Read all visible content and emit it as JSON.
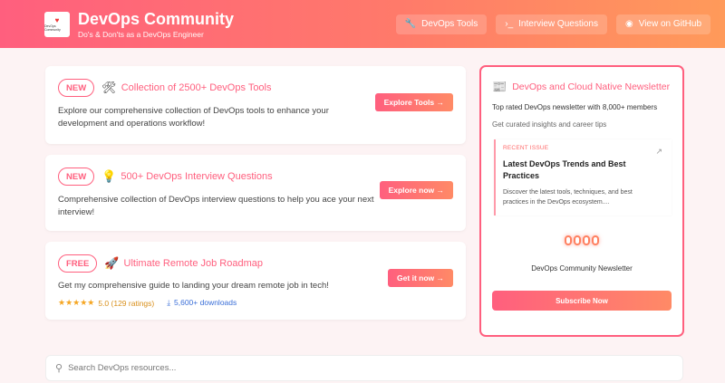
{
  "header": {
    "title": "DevOps Community",
    "subtitle": "Do's & Don'ts as a DevOps Engineer",
    "logo_text": "DevOps Community",
    "nav": [
      {
        "label": "DevOps Tools",
        "icon": "wrench-icon"
      },
      {
        "label": "Interview Questions",
        "icon": "terminal-icon"
      },
      {
        "label": "View on GitHub",
        "icon": "github-icon"
      }
    ]
  },
  "cards": [
    {
      "badge": "NEW",
      "icon": "tools-icon",
      "title": "Collection of 2500+ DevOps Tools",
      "desc": "Explore our comprehensive collection of DevOps tools to enhance your development and operations workflow!",
      "cta": "Explore Tools →"
    },
    {
      "badge": "NEW",
      "icon": "lightbulb-icon",
      "title": "500+ DevOps Interview Questions",
      "desc": "Comprehensive collection of DevOps interview questions to help you ace your next interview!",
      "cta": "Explore now →"
    },
    {
      "badge": "FREE",
      "icon": "rocket-icon",
      "title": "Ultimate Remote Job Roadmap",
      "desc": "Get my comprehensive guide to landing your dream remote job in tech!",
      "cta": "Get it now →",
      "rating": {
        "stars": 5,
        "text": "5.0 (129 ratings)"
      },
      "downloads": "5,600+ downloads"
    }
  ],
  "newsletter": {
    "title": "DevOps and Cloud Native Newsletter",
    "top": "Top rated DevOps newsletter with 8,000+ members",
    "sub": "Get curated insights and career tips",
    "issue": {
      "label": "RECENT ISSUE",
      "title": "Latest DevOps Trends and Best Practices",
      "desc": "Discover the latest tools, techniques, and best practices in the DevOps ecosystem...."
    },
    "name": "DevOps Community Newsletter",
    "subscribe": "Subscribe Now"
  },
  "search": {
    "placeholder": "Search DevOps resources..."
  },
  "colors": {
    "accent": "#ff5f7e",
    "accent2": "#ff9a5a",
    "star": "#f5a623",
    "link": "#3b6fd8"
  }
}
